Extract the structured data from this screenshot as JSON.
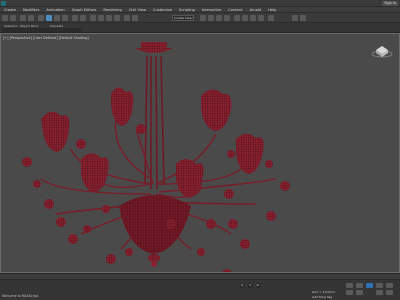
{
  "menu": [
    "Create",
    "Modifiers",
    "Animation",
    "Graph Editors",
    "Rendering",
    "Civil View",
    "Customize",
    "Scripting",
    "Interactive",
    "Content",
    "Arnold",
    "Help"
  ],
  "toolbar": {
    "selection_set_placeholder": "Create Selection Set"
  },
  "ribbon": {
    "tab1": "Selection",
    "tab2": "Object Paint",
    "tab3": "Populate"
  },
  "viewport": {
    "label": "[+] [Perspective] [User Defined] [Default Shading]"
  },
  "titlebar": {
    "signin": "Sign In"
  },
  "status": {
    "left": "Welcome to MAXScript.",
    "grid": "Grid = 10,0mm",
    "add_time": "Add Time Tag"
  },
  "coords": {
    "x": "X:",
    "y": "Y:",
    "z": "Z:"
  },
  "colors": {
    "model": "#8a2130",
    "model_dark": "#3a0a12",
    "viewport_bg": "#4a4a4a",
    "accent": "#4f8fc0"
  }
}
